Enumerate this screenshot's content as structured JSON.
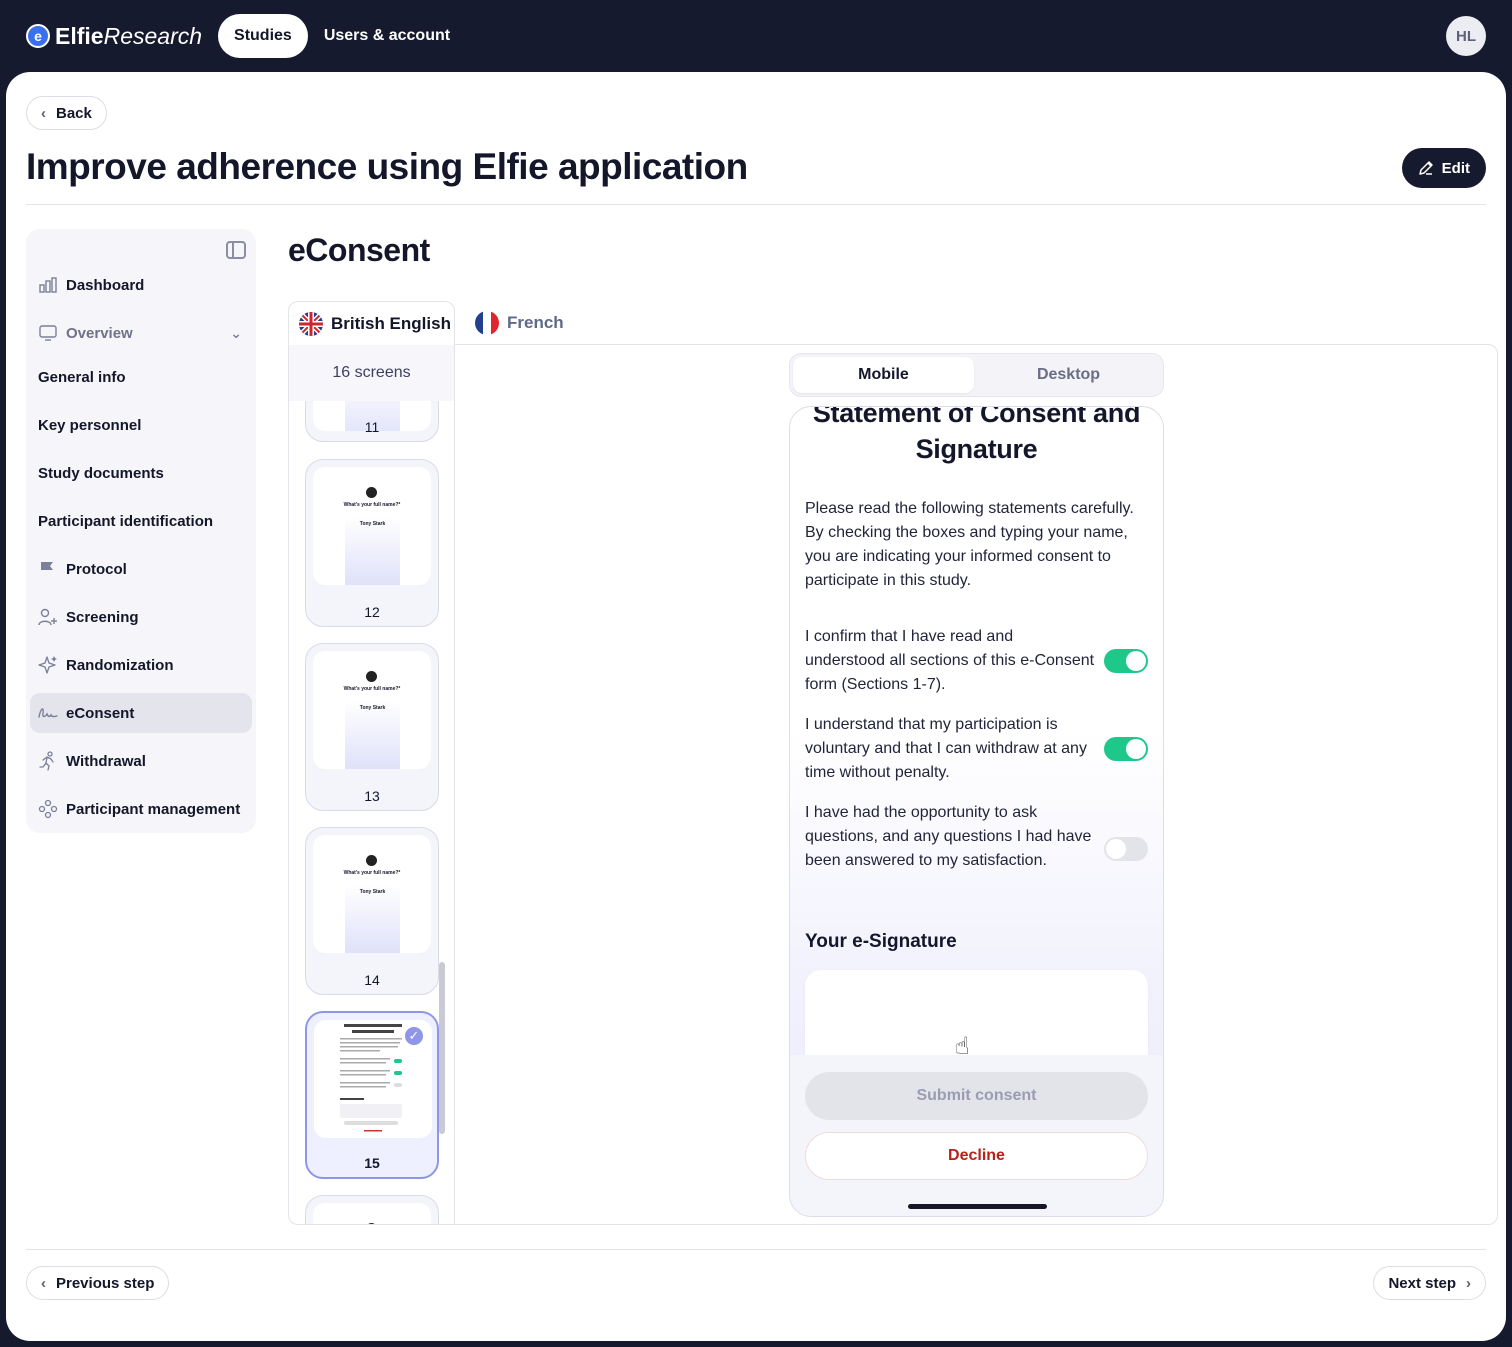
{
  "brand": {
    "bold": "Elfie",
    "italic": "Research"
  },
  "nav": {
    "studies": "Studies",
    "users": "Users & account",
    "avatar_initials": "HL"
  },
  "back_label": "Back",
  "page_title": "Improve adherence using Elfie application",
  "edit_label": "Edit",
  "sidebar": {
    "items": [
      {
        "label": "Dashboard",
        "icon": "chart-icon"
      },
      {
        "label": "Overview",
        "icon": "monitor-icon"
      },
      {
        "label": "General info"
      },
      {
        "label": "Key personnel"
      },
      {
        "label": "Study documents"
      },
      {
        "label": "Participant identification"
      },
      {
        "label": "Protocol",
        "icon": "flag-icon"
      },
      {
        "label": "Screening",
        "icon": "user-plus-icon"
      },
      {
        "label": "Randomization",
        "icon": "sparkle-icon"
      },
      {
        "label": "eConsent",
        "icon": "signature-icon"
      },
      {
        "label": "Withdrawal",
        "icon": "running-icon"
      },
      {
        "label": "Participant management",
        "icon": "people-icon"
      }
    ],
    "active": "eConsent"
  },
  "section_title": "eConsent",
  "languages": {
    "active": "British English",
    "other": "French"
  },
  "screens_count": "16 screens",
  "thumbnails": [
    {
      "num": "11"
    },
    {
      "num": "12",
      "question": "What's your full name?*",
      "name": "Tony Stark"
    },
    {
      "num": "13",
      "question": "What's your full name?*",
      "name": "Tony Stark"
    },
    {
      "num": "14",
      "question": "What's your full name?*",
      "name": "Tony Stark"
    },
    {
      "num": "15",
      "selected": true
    }
  ],
  "view_toggle": {
    "mobile": "Mobile",
    "desktop": "Desktop",
    "active": "Mobile"
  },
  "phone": {
    "title": "Statement of Consent and Signature",
    "intro": "Please read the following statements carefully. By checking the boxes and typing your name, you are indicating your informed consent to participate in this study.",
    "statements": [
      {
        "text": "I confirm that I have read and understood all sections of this e-Consent form (Sections 1-7).",
        "checked": true
      },
      {
        "text": "I understand that my participation is voluntary and that I can withdraw at any time without penalty.",
        "checked": true
      },
      {
        "text": "I have had the opportunity to ask questions, and any questions I had have been answered to my satisfaction.",
        "checked": false
      }
    ],
    "signature_label": "Your e-Signature",
    "submit_label": "Submit consent",
    "decline_label": "Decline"
  },
  "footer": {
    "previous": "Previous step",
    "next": "Next step"
  },
  "colors": {
    "toggle_on": "#1ec88a",
    "decline": "#b5231a",
    "nav_bg": "#161a2e",
    "selected_thumb": "#8f96e8"
  }
}
